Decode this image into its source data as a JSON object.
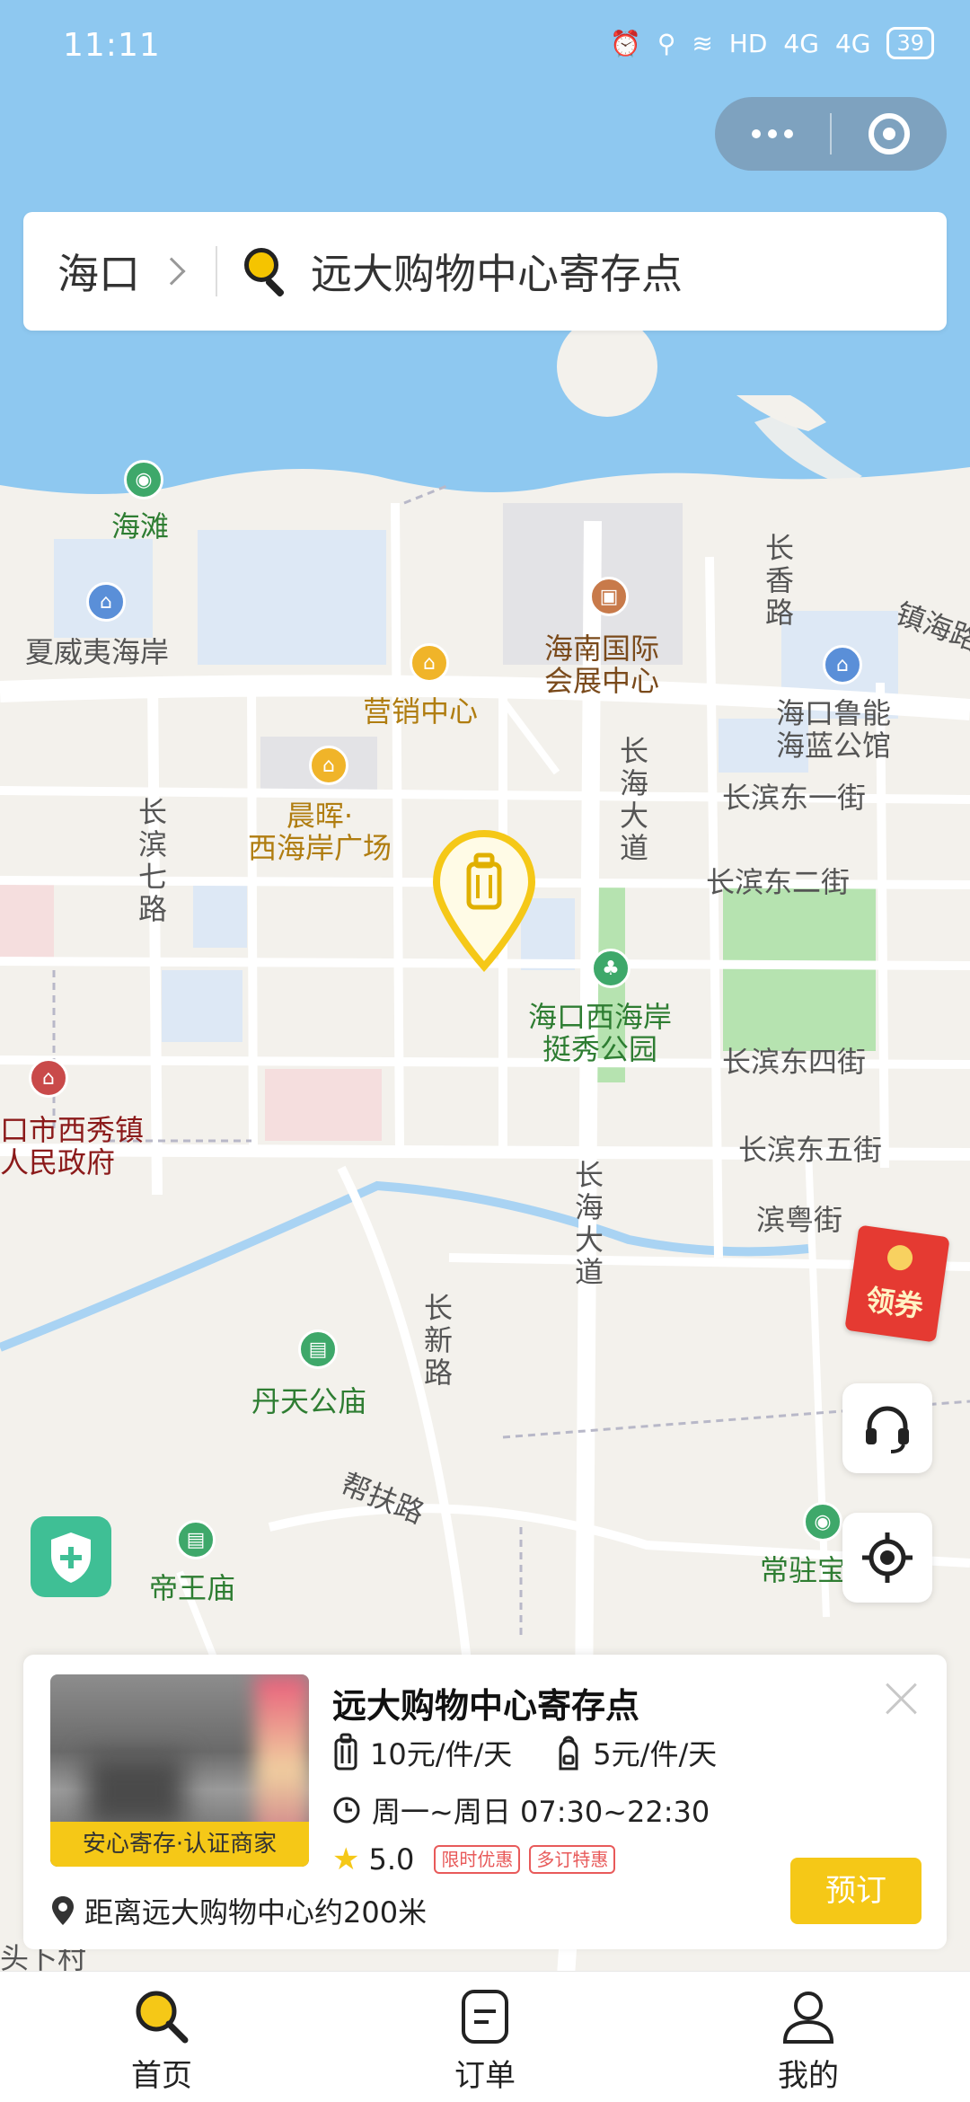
{
  "status_bar": {
    "time": "11:11",
    "network": "HD",
    "signal1": "4G",
    "signal2": "4G",
    "battery": "39"
  },
  "search": {
    "city": "海口",
    "query": "远大购物中心寄存点"
  },
  "map_labels": {
    "beach": "海滩",
    "hawaii": "夏威夷海岸",
    "yingxiao": "营销中心",
    "hainan_expo": "海南国际\n会展中心",
    "changxiang": "长香路",
    "zhenhai": "镇海路",
    "lumeng": "海口鲁能\n海蓝公馆",
    "chenhui": "晨晖·\n西海岸广场",
    "changbin7": "长滨七路",
    "changhai1": "长海大道",
    "changbin_e1": "长滨东一街",
    "changbin_e2": "长滨东二街",
    "park": "海口西海岸\n挺秀公园",
    "changbin_e4": "长滨东四街",
    "xixiu": "口市西秀镇\n人民政府",
    "changbin_e5": "长滨东五街",
    "changhai2": "长海大道",
    "binyue": "滨粤街",
    "changxin": "长新路",
    "dantian": "丹天公庙",
    "bangfu": "帮扶路",
    "diwang": "帝王庙",
    "changzhu": "常驻宝",
    "village": "头卜村"
  },
  "coupon": {
    "label": "领券"
  },
  "info_card": {
    "thumb_tag": "安心寄存·认证商家",
    "name": "远大购物中心寄存点",
    "price_luggage": "10元/件/天",
    "price_bag": "5元/件/天",
    "hours": "周一~周日 07:30~22:30",
    "rating": "5.0",
    "tag1": "限时优惠",
    "tag2": "多订特惠",
    "distance": "距离远大购物中心约200米",
    "book_label": "预订"
  },
  "nav": {
    "items": [
      {
        "label": "首页",
        "icon": "search-icon"
      },
      {
        "label": "订单",
        "icon": "order-icon"
      },
      {
        "label": "我的",
        "icon": "user-icon"
      }
    ]
  },
  "colors": {
    "accent": "#f5c817",
    "water": "#8ec8f0",
    "land": "#f3f1ec",
    "road": "#ffffff",
    "park": "#b6e3b0"
  }
}
